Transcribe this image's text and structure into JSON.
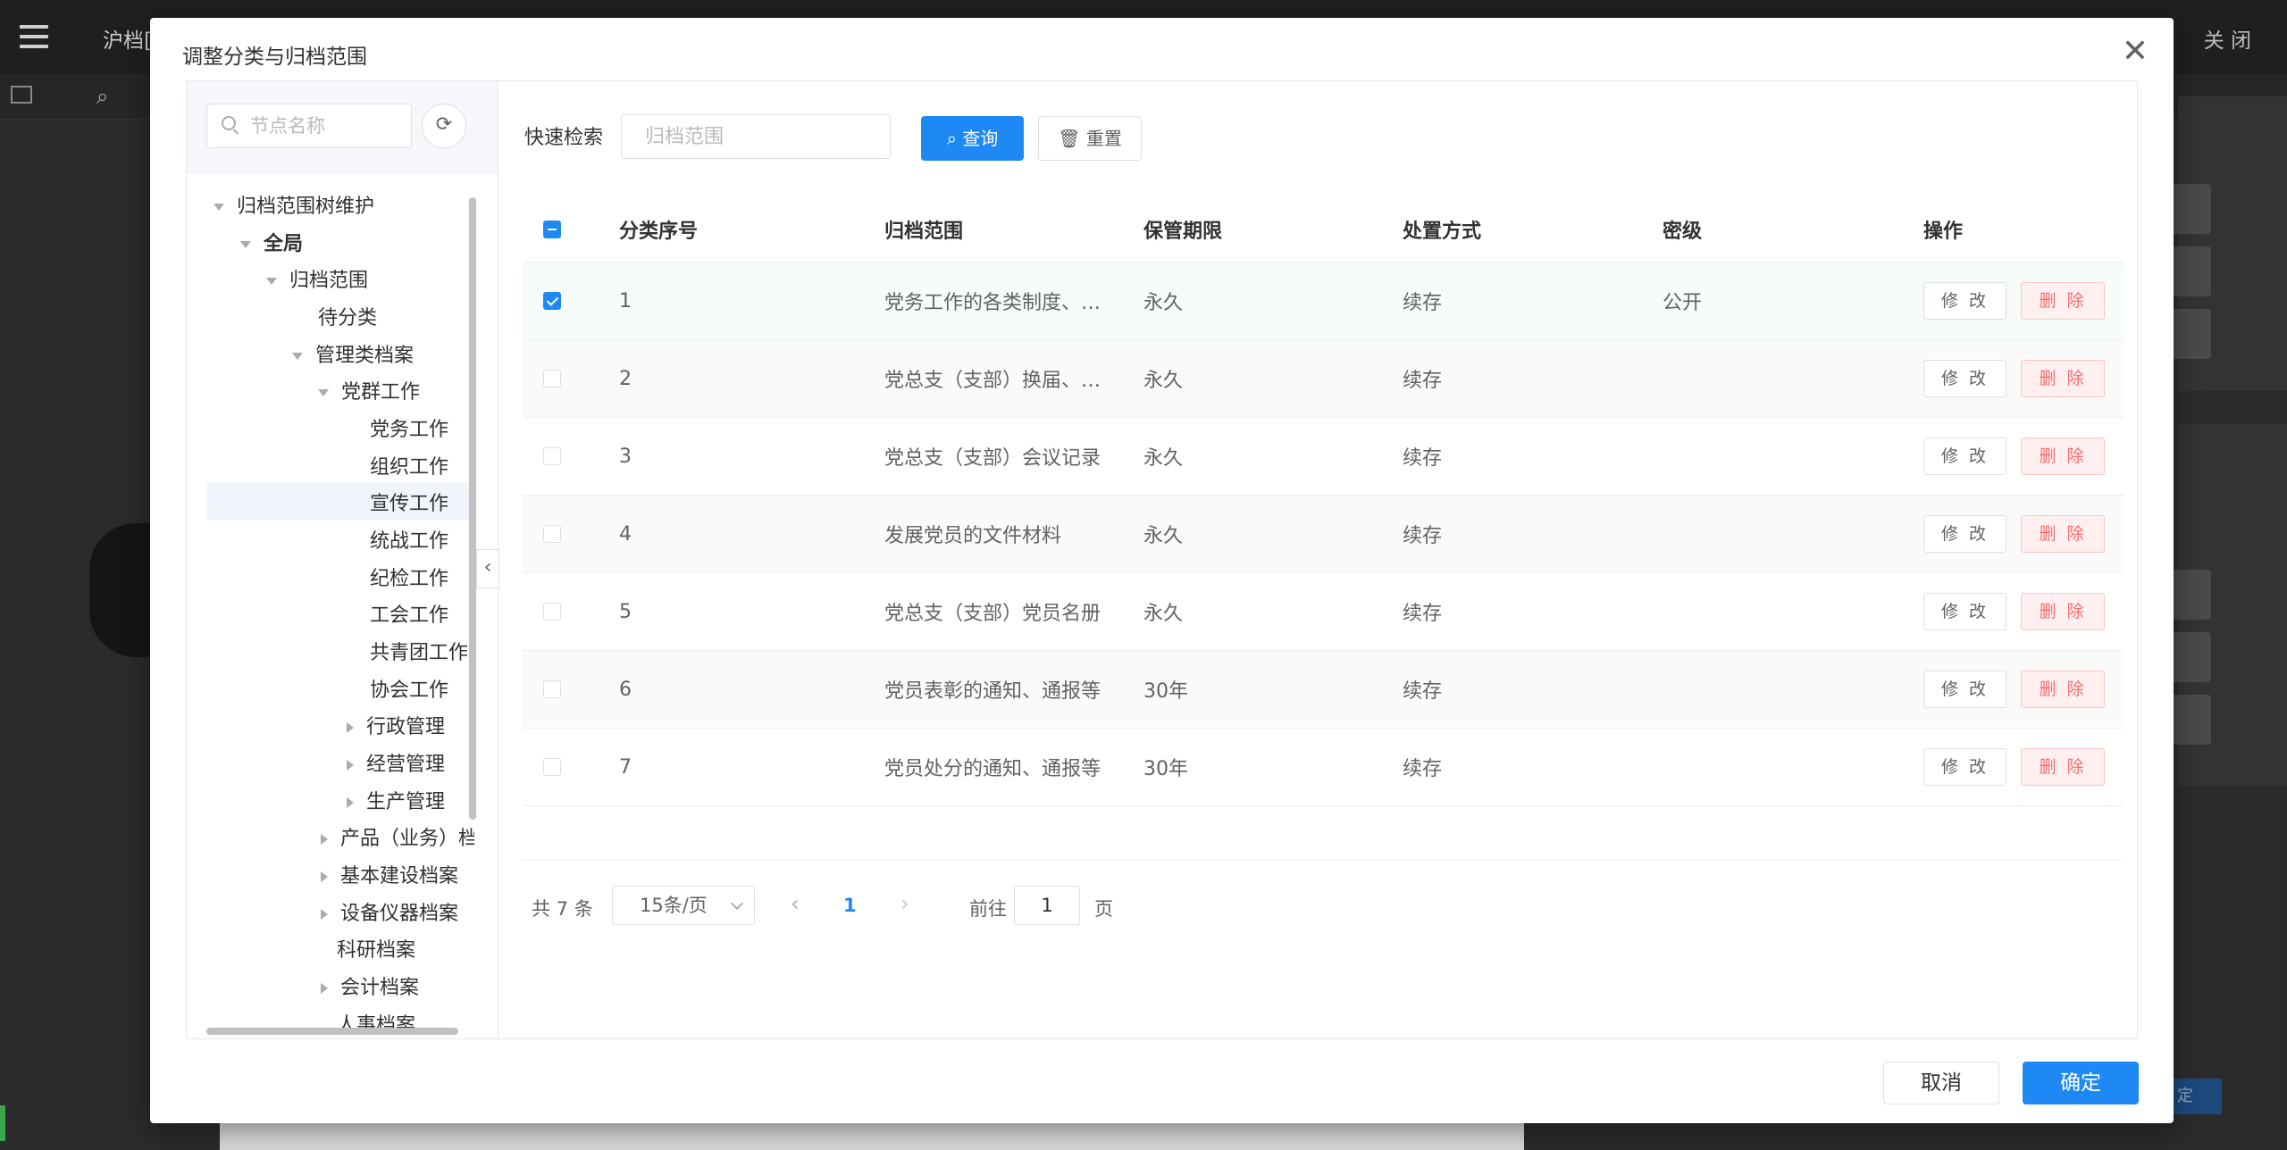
{
  "background": {
    "title": "沪档[",
    "close_label": "关 闭",
    "bottom_button": "定"
  },
  "modal": {
    "title": "调整分类与归档范围",
    "cancel_label": "取消",
    "ok_label": "确定"
  },
  "tree": {
    "search_placeholder": "节点名称",
    "nodes": [
      {
        "label": "归档范围树维护",
        "arrow": "down"
      },
      {
        "label": "全局",
        "arrow": "down"
      },
      {
        "label": "归档范围",
        "arrow": "down"
      },
      {
        "label": "待分类",
        "arrow": "none"
      },
      {
        "label": "管理类档案",
        "arrow": "down"
      },
      {
        "label": "党群工作",
        "arrow": "down"
      },
      {
        "label": "党务工作",
        "arrow": "none"
      },
      {
        "label": "组织工作",
        "arrow": "none"
      },
      {
        "label": "宣传工作",
        "arrow": "none"
      },
      {
        "label": "统战工作",
        "arrow": "none"
      },
      {
        "label": "纪检工作",
        "arrow": "none"
      },
      {
        "label": "工会工作",
        "arrow": "none"
      },
      {
        "label": "共青团工作",
        "arrow": "none"
      },
      {
        "label": "协会工作",
        "arrow": "none"
      },
      {
        "label": "行政管理",
        "arrow": "right"
      },
      {
        "label": "经营管理",
        "arrow": "right"
      },
      {
        "label": "生产管理",
        "arrow": "right"
      },
      {
        "label": "产品（业务）档案",
        "arrow": "right"
      },
      {
        "label": "基本建设档案",
        "arrow": "right"
      },
      {
        "label": "设备仪器档案",
        "arrow": "right"
      },
      {
        "label": "科研档案",
        "arrow": "none"
      },
      {
        "label": "会计档案",
        "arrow": "right"
      },
      {
        "label": "人事档案",
        "arrow": "none"
      }
    ]
  },
  "search": {
    "label": "快速检索",
    "placeholder": "归档范围",
    "query_label": "查询",
    "reset_label": "重置"
  },
  "table": {
    "headers": [
      "分类序号",
      "归档范围",
      "保管期限",
      "处置方式",
      "密级",
      "操作"
    ],
    "edit_label": "修 改",
    "delete_label": "删 除",
    "rows": [
      {
        "no": "1",
        "scope": "党务工作的各类制度、规定",
        "period": "永久",
        "disposal": "续存",
        "secret": "公开",
        "checked": true
      },
      {
        "no": "2",
        "scope": "党总支（支部）换届、选举",
        "period": "永久",
        "disposal": "续存",
        "secret": "",
        "checked": false
      },
      {
        "no": "3",
        "scope": "党总支（支部）会议记录",
        "period": "永久",
        "disposal": "续存",
        "secret": "",
        "checked": false
      },
      {
        "no": "4",
        "scope": "发展党员的文件材料",
        "period": "永久",
        "disposal": "续存",
        "secret": "",
        "checked": false
      },
      {
        "no": "5",
        "scope": "党总支（支部）党员名册",
        "period": "永久",
        "disposal": "续存",
        "secret": "",
        "checked": false
      },
      {
        "no": "6",
        "scope": "党员表彰的通知、通报等",
        "period": "30年",
        "disposal": "续存",
        "secret": "",
        "checked": false
      },
      {
        "no": "7",
        "scope": "党员处分的通知、通报等",
        "period": "30年",
        "disposal": "续存",
        "secret": "",
        "checked": false
      }
    ]
  },
  "pager": {
    "total": "共 7 条",
    "page_size": "15条/页",
    "current": "1",
    "goto_label": "前往",
    "goto_value": "1",
    "page_suffix": "页"
  }
}
